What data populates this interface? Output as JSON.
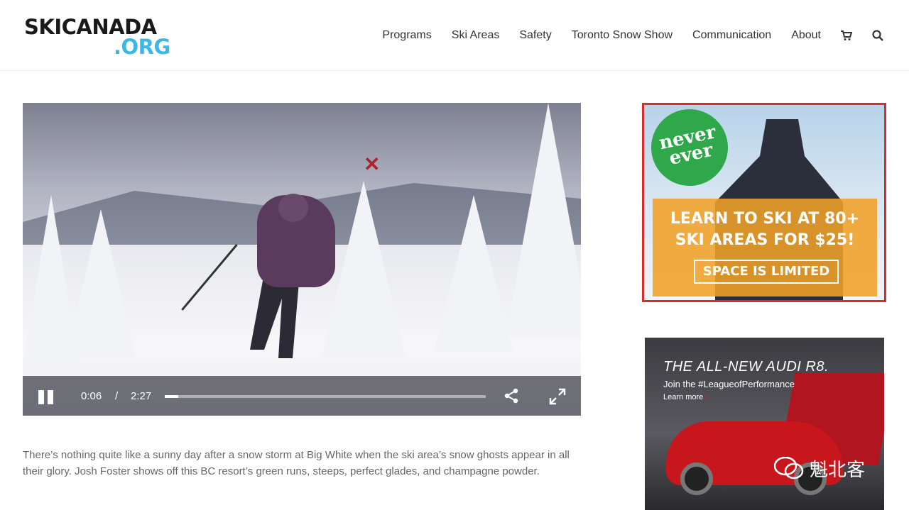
{
  "header": {
    "logo_top": "SKICANADA",
    "logo_bottom": ".ORG",
    "nav": [
      "Programs",
      "Ski Areas",
      "Safety",
      "Toronto Snow Show",
      "Communication",
      "About"
    ],
    "icons": [
      "cart-icon",
      "search-icon"
    ]
  },
  "video": {
    "current_time": "0:06",
    "separator": "/",
    "duration": "2:27",
    "progress_fraction": 0.041,
    "icons": [
      "pause-icon",
      "share-icon",
      "fullscreen-icon"
    ]
  },
  "description": "There’s nothing quite like a sunny day after a snow storm at Big White when the ski area’s snow ghosts appear in all their glory. Josh Foster shows off this BC resort’s green runs, steeps, perfect glades, and champagne powder.",
  "ad_neverever": {
    "badge": "never ever",
    "headline_1": "LEARN TO SKI AT 80+",
    "headline_2": "SKI AREAS FOR $25!",
    "button": "SPACE IS LIMITED",
    "colors": {
      "border": "#d72c2c",
      "badge": "#2ea84a",
      "box": "#f0a028"
    }
  },
  "ad_audi": {
    "title": "THE ALL-NEW AUDI R8.",
    "subtitle": "Join the #LeagueofPerformance",
    "learn_more": "Learn more",
    "colors": {
      "car": "#c8161d"
    }
  },
  "watermark": {
    "text": "魁北客"
  },
  "colors": {
    "logo_accent": "#3fb7e6",
    "nav_text": "#333333"
  }
}
